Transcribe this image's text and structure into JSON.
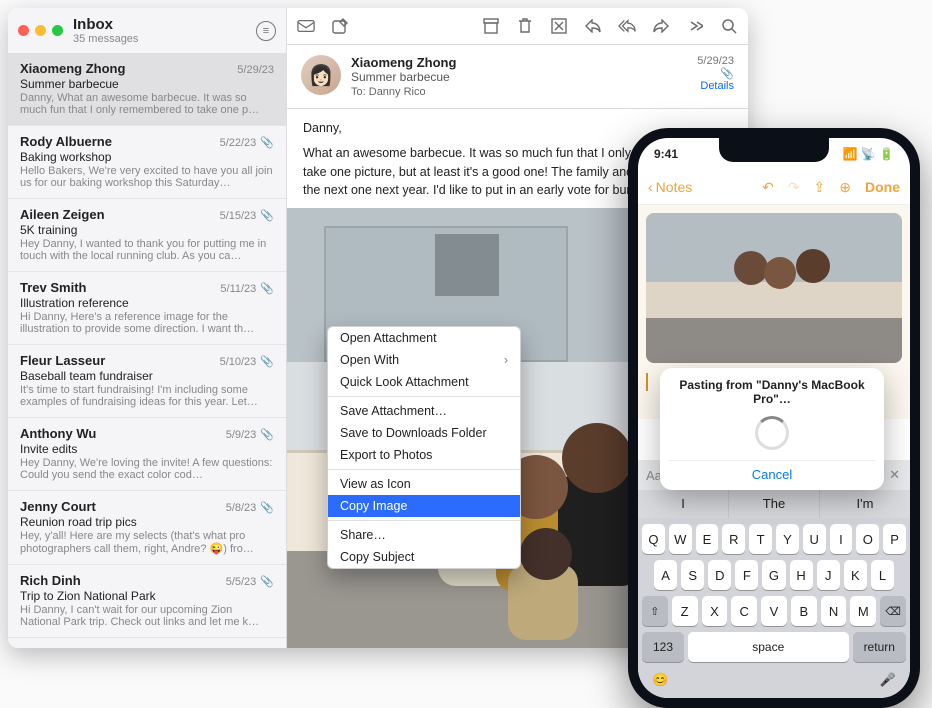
{
  "mail": {
    "inbox_title": "Inbox",
    "inbox_subtitle": "35 messages",
    "toolbar": {
      "mailboxes": "mailboxes",
      "compose": "compose",
      "archive": "archive",
      "trash": "trash",
      "junk": "junk",
      "reply": "reply",
      "reply_all": "reply-all",
      "forward": "forward",
      "more": "more",
      "search": "search"
    },
    "header": {
      "from": "Xiaomeng Zhong",
      "subject": "Summer barbecue",
      "to_label": "To:",
      "to_value": "Danny Rico",
      "date": "5/29/23",
      "details": "Details"
    },
    "body": {
      "greeting": "Danny,",
      "p": "What an awesome barbecue. It was so much fun that I only remembered to take one picture, but at least it's a good one! The family and I can't wait until the next one next year. I'd like to put in an early vote for burgers. 🍔"
    },
    "messages": [
      {
        "from": "Xiaomeng Zhong",
        "date": "5/29/23",
        "subject": "Summer barbecue",
        "preview": "Danny, What an awesome barbecue. It was so much fun that I only remembered to take one p…",
        "selected": true,
        "attachment": false
      },
      {
        "from": "Rody Albuerne",
        "date": "5/22/23",
        "subject": "Baking workshop",
        "preview": "Hello Bakers, We're very excited to have you all join us for our baking workshop this Saturday…",
        "attachment": true
      },
      {
        "from": "Aileen Zeigen",
        "date": "5/15/23",
        "subject": "5K training",
        "preview": "Hey Danny, I wanted to thank you for putting me in touch with the local running club. As you ca…",
        "attachment": true
      },
      {
        "from": "Trev Smith",
        "date": "5/11/23",
        "subject": "Illustration reference",
        "preview": "Hi Danny, Here's a reference image for the illustration to provide some direction. I want th…",
        "attachment": true
      },
      {
        "from": "Fleur Lasseur",
        "date": "5/10/23",
        "subject": "Baseball team fundraiser",
        "preview": "It's time to start fundraising! I'm including some examples of fundraising ideas for this year. Let…",
        "attachment": true
      },
      {
        "from": "Anthony Wu",
        "date": "5/9/23",
        "subject": "Invite edits",
        "preview": "Hey Danny, We're loving the invite! A few questions: Could you send the exact color cod…",
        "attachment": true
      },
      {
        "from": "Jenny Court",
        "date": "5/8/23",
        "subject": "Reunion road trip pics",
        "preview": "Hey, y'all! Here are my selects (that's what pro photographers call them, right, Andre? 😜) fro…",
        "attachment": true
      },
      {
        "from": "Rich Dinh",
        "date": "5/5/23",
        "subject": "Trip to Zion National Park",
        "preview": "Hi Danny, I can't wait for our upcoming Zion National Park trip. Check out links and let me k…",
        "attachment": true
      }
    ]
  },
  "context_menu": {
    "items": [
      {
        "label": "Open Attachment"
      },
      {
        "label": "Open With",
        "submenu": true
      },
      {
        "label": "Quick Look Attachment"
      },
      {
        "sep": true
      },
      {
        "label": "Save Attachment…"
      },
      {
        "label": "Save to Downloads Folder"
      },
      {
        "label": "Export to Photos"
      },
      {
        "sep": true
      },
      {
        "label": "View as Icon"
      },
      {
        "label": "Copy Image",
        "highlight": true
      },
      {
        "sep": true
      },
      {
        "label": "Share…"
      },
      {
        "label": "Copy Subject"
      }
    ]
  },
  "iphone": {
    "status_time": "9:41",
    "back_label": "Notes",
    "done_label": "Done",
    "popover_text": "Pasting from \"Danny's MacBook Pro\"…",
    "popover_cancel": "Cancel",
    "autocomplete_label": "Aa",
    "suggestions": [
      "I",
      "The",
      "I'm"
    ],
    "keyboard": {
      "r1": [
        "Q",
        "W",
        "E",
        "R",
        "T",
        "Y",
        "U",
        "I",
        "O",
        "P"
      ],
      "r2": [
        "A",
        "S",
        "D",
        "F",
        "G",
        "H",
        "J",
        "K",
        "L"
      ],
      "r3": [
        "Z",
        "X",
        "C",
        "V",
        "B",
        "N",
        "M"
      ],
      "shift": "⇧",
      "bksp": "⌫",
      "num": "123",
      "space": "space",
      "return": "return",
      "emoji": "😊",
      "mic": "🎤"
    }
  }
}
